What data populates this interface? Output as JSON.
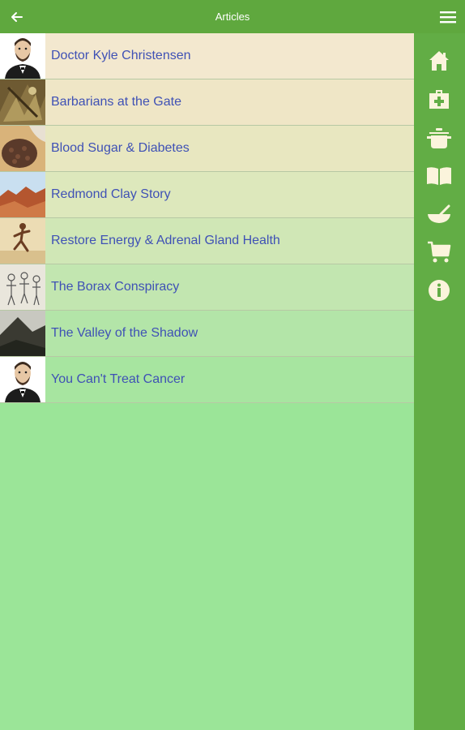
{
  "header": {
    "title": "Articles",
    "back_icon": "back-arrow-icon",
    "menu_icon": "hamburger-menu-icon"
  },
  "articles": [
    {
      "title": "Doctor Kyle Christensen",
      "bg": "#f3e8cf",
      "thumb": "portrait-thumbnail"
    },
    {
      "title": "Barbarians at the Gate",
      "bg": "#efe6c6",
      "thumb": "barbarians-thumbnail"
    },
    {
      "title": "Blood Sugar & Diabetes",
      "bg": "#e8e7c0",
      "thumb": "spices-thumbnail"
    },
    {
      "title": "Redmond Clay Story",
      "bg": "#dde8bc",
      "thumb": "desert-thumbnail"
    },
    {
      "title": "Restore Energy & Adrenal Gland Health",
      "bg": "#d0e7b6",
      "thumb": "runner-thumbnail"
    },
    {
      "title": "The Borax Conspiracy",
      "bg": "#c2e6b0",
      "thumb": "sketch-thumbnail"
    },
    {
      "title": "The Valley of the Shadow",
      "bg": "#b3e5a8",
      "thumb": "mountain-thumbnail"
    },
    {
      "title": "You Can't Treat Cancer",
      "bg": "#a7e5a0",
      "thumb": "portrait-thumbnail"
    }
  ],
  "sidebar": {
    "icons": [
      "home-icon",
      "medical-kit-icon",
      "cooking-pot-icon",
      "book-icon",
      "mortar-bowl-icon",
      "shopping-cart-icon",
      "info-icon"
    ],
    "icon_color": "#fbf4dc"
  },
  "colors": {
    "topbar": "#5fa83e",
    "sidebar": "#62ad45",
    "background": "#9be598",
    "link": "#3f51b5"
  }
}
